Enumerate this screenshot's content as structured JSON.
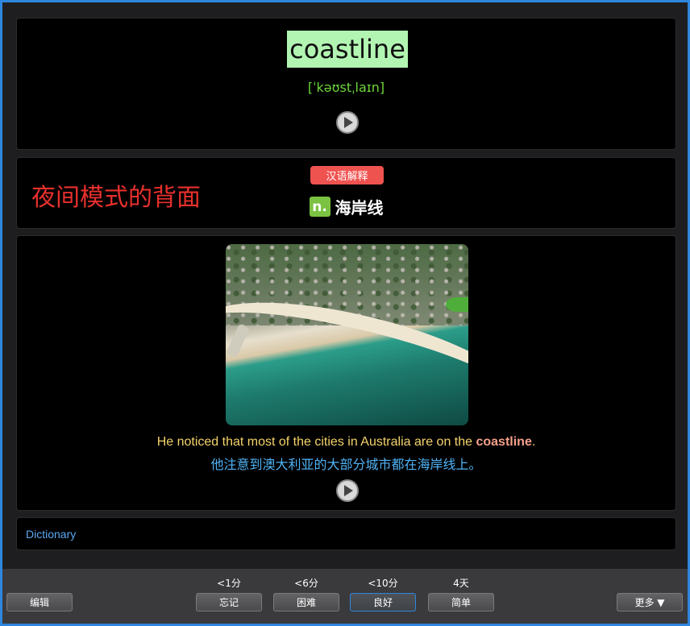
{
  "word_card": {
    "word": "coastline",
    "phonetic": "[ˈkəʊstˌlaɪn]"
  },
  "meaning_card": {
    "night_mode_label": "夜间模式的背面",
    "tag": "汉语解释",
    "pos": "n.",
    "definition": "海岸线"
  },
  "example_card": {
    "sentence_en_before": "He noticed that most of the cities in Australia are on the ",
    "sentence_en_highlight": "coastline",
    "sentence_en_after": ".",
    "sentence_zh": "他注意到澳大利亚的大部分城市都在海岸线上。"
  },
  "dictionary_card": {
    "label": "Dictionary"
  },
  "bottom_bar": {
    "edit_label": "编辑",
    "more_label": "更多 ▼",
    "answers": [
      {
        "interval": "<1分",
        "label": "忘记"
      },
      {
        "interval": "<6分",
        "label": "困难"
      },
      {
        "interval": "<10分",
        "label": "良好"
      },
      {
        "interval": "4天",
        "label": "简单"
      }
    ]
  },
  "colors": {
    "frame_border": "#2e86de",
    "word_highlight_bg": "#b2f5b2",
    "phonetic": "#6dd63a",
    "night_label": "#e8302d",
    "tag_bg": "#ef5350",
    "pos_bg": "#7cc242",
    "sentence_en": "#f5d36b",
    "sentence_highlight": "#f4a08a",
    "sentence_zh": "#4fb3f6",
    "dictionary_link": "#5aa9f3"
  },
  "icons": {
    "play": "play-circle-icon"
  }
}
